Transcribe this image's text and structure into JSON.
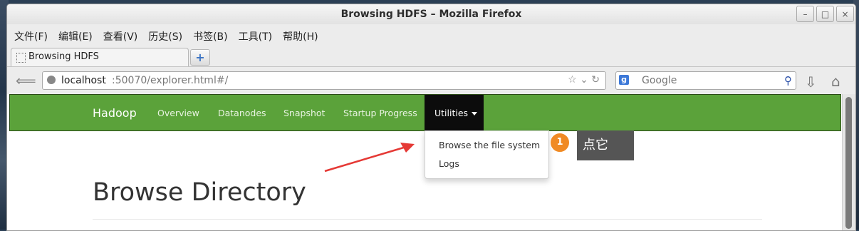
{
  "window": {
    "title": "Browsing HDFS – Mozilla Firefox"
  },
  "menubar": [
    "文件(F)",
    "编辑(E)",
    "查看(V)",
    "历史(S)",
    "书签(B)",
    "工具(T)",
    "帮助(H)"
  ],
  "tab": {
    "label": "Browsing HDFS",
    "new_tab": "+"
  },
  "address": {
    "host": "localhost",
    "rest": ":50070/explorer.html#/"
  },
  "search": {
    "placeholder": "Google",
    "engine": "g"
  },
  "page": {
    "brand": "Hadoop",
    "nav": [
      "Overview",
      "Datanodes",
      "Snapshot",
      "Startup Progress"
    ],
    "active_menu": "Utilities",
    "dropdown": [
      "Browse the file system",
      "Logs"
    ],
    "heading": "Browse Directory"
  },
  "annotation": {
    "badge": "1",
    "tip": "点它"
  },
  "colors": {
    "navbar": "#5ba23a",
    "active": "#0c0c0c",
    "badge": "#f08a24",
    "arrow": "#e53935"
  }
}
